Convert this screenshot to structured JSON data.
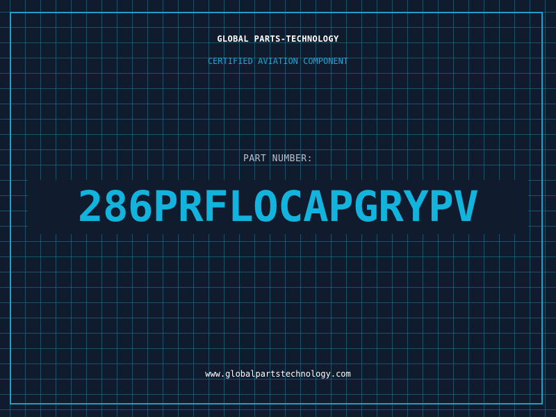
{
  "header": {
    "company": "GLOBAL PARTS-TECHNOLOGY",
    "subtitle": "CERTIFIED AVIATION COMPONENT"
  },
  "part": {
    "label": "PART NUMBER:",
    "number": "286PRFLOCAPGRYPV"
  },
  "footer": {
    "url": "www.globalpartstechnology.com"
  },
  "colors": {
    "background": "#111b2e",
    "grid": "#267e96",
    "accent": "#12b4dd",
    "frame": "#1ea0c8",
    "label": "#b9c2cf",
    "text": "#ffffff"
  }
}
